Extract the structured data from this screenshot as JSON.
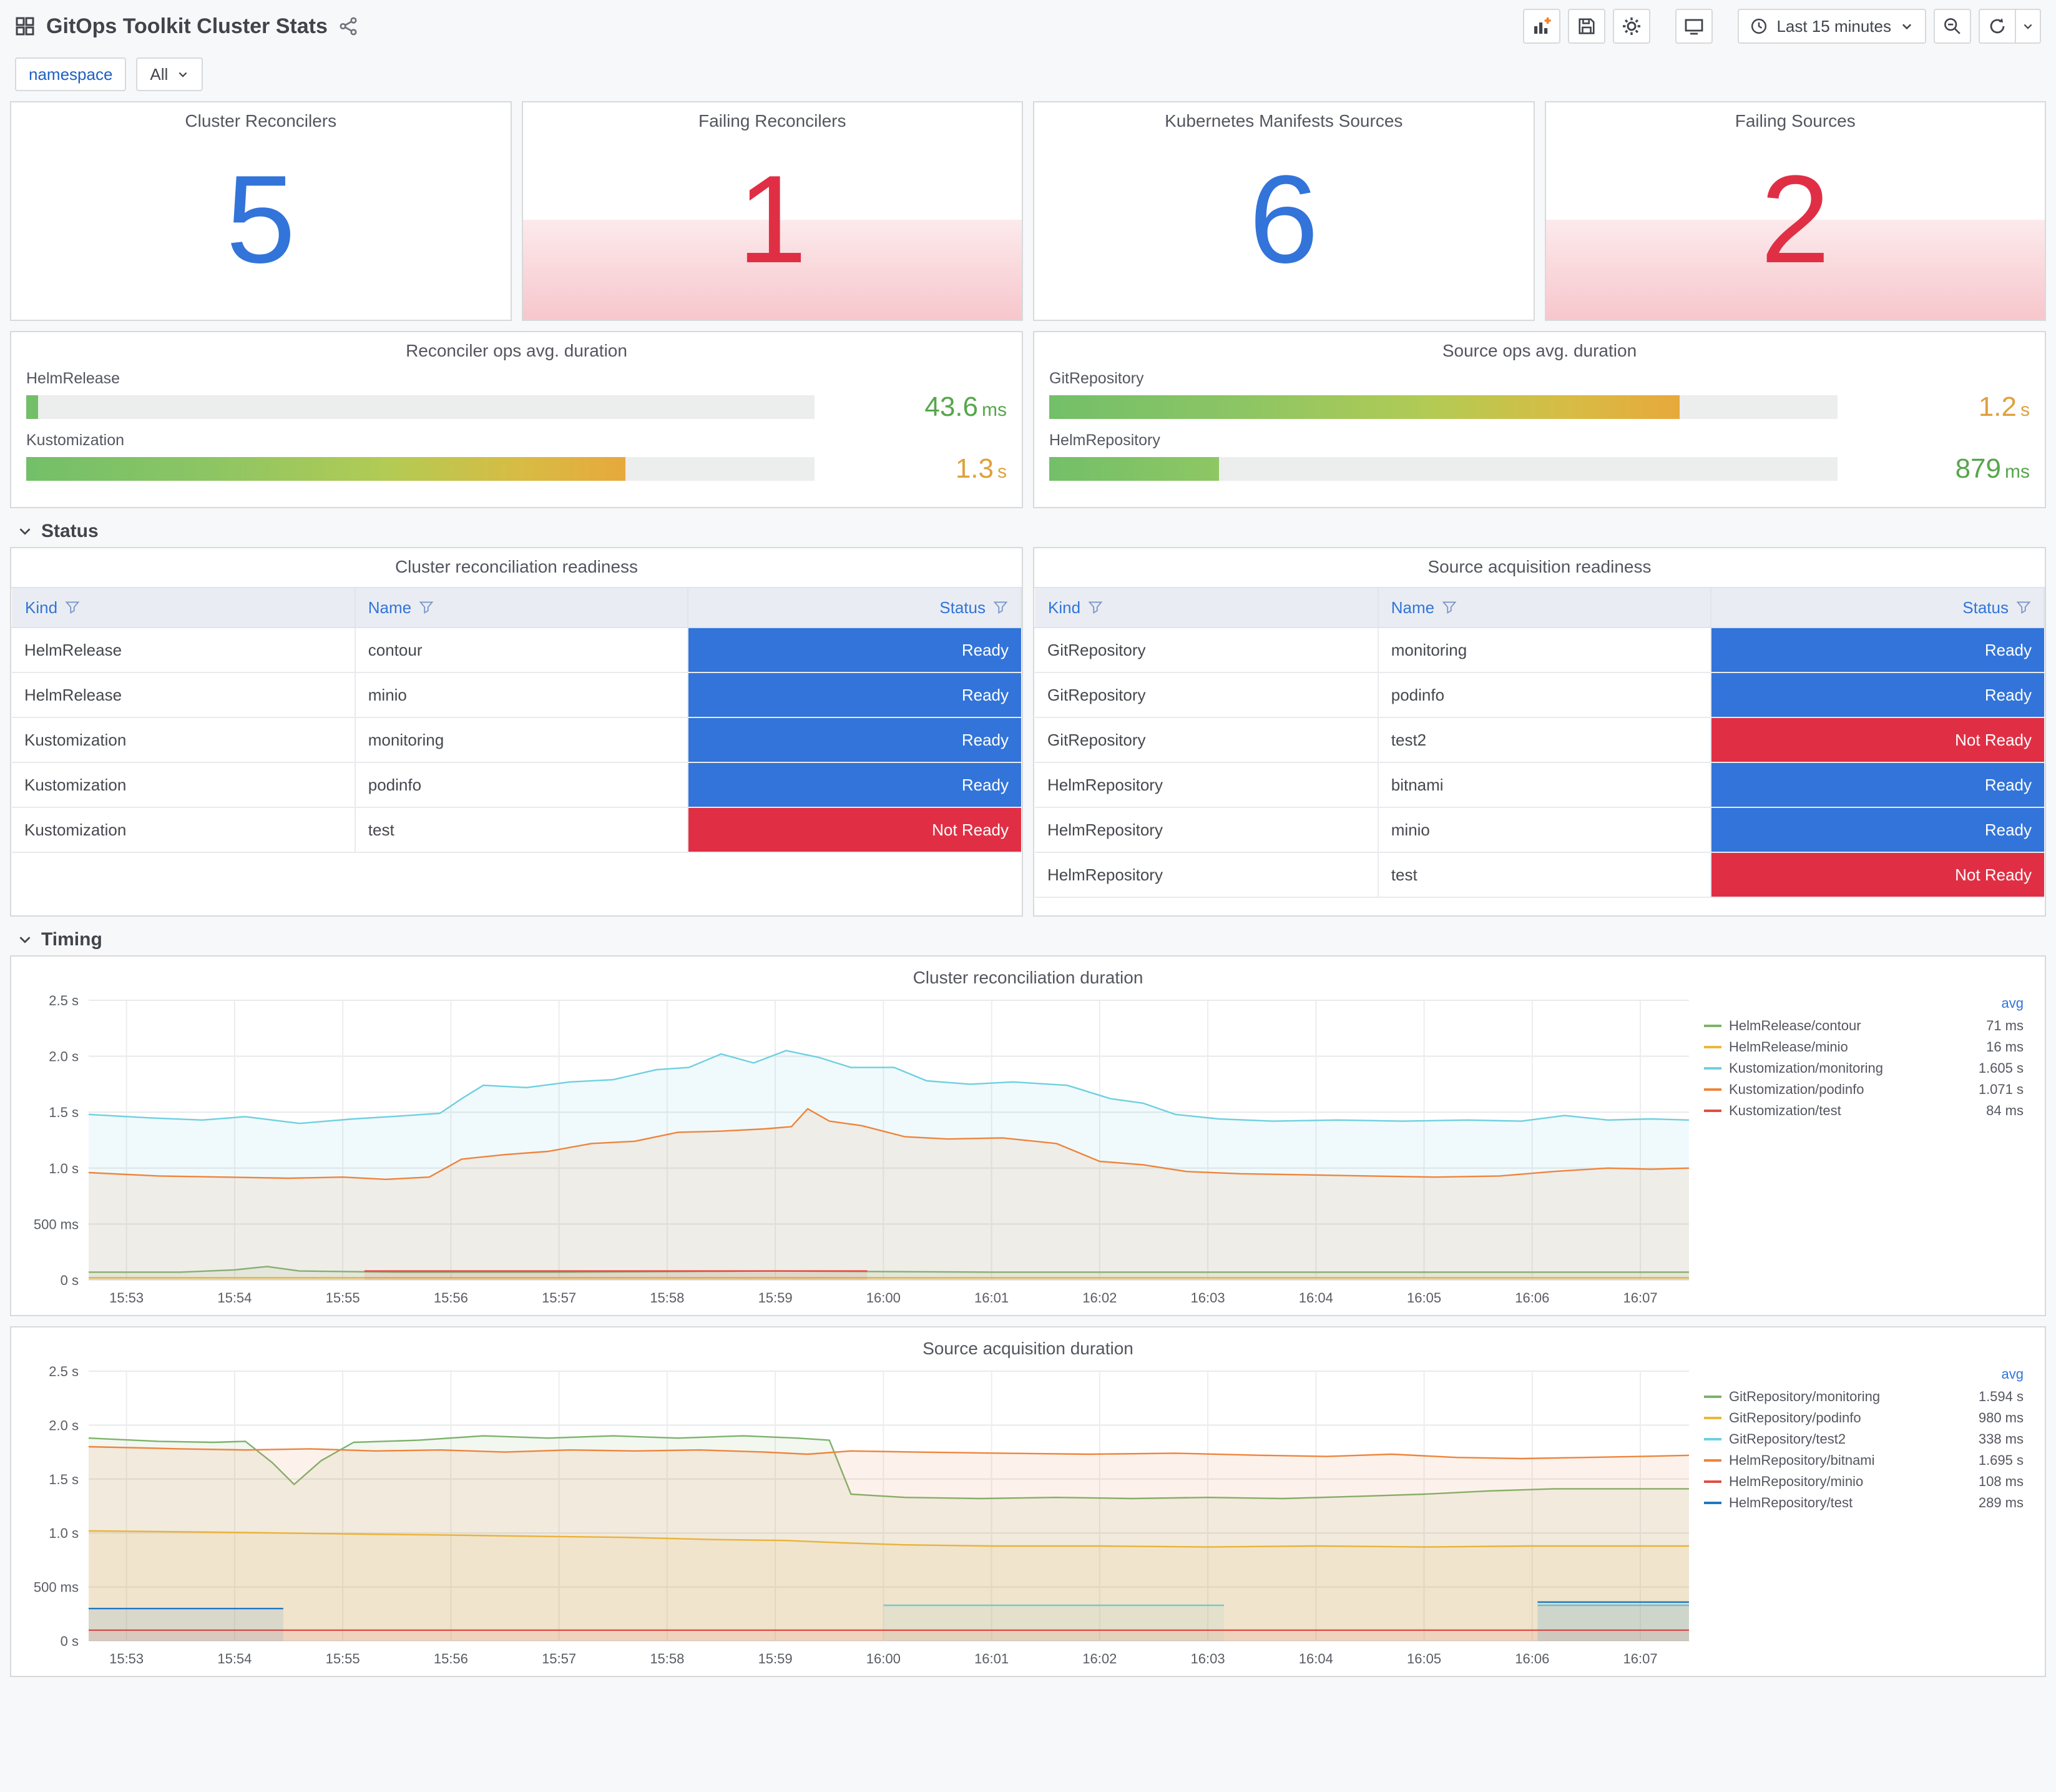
{
  "header": {
    "title": "GitOps Toolkit Cluster Stats",
    "time_picker": "Last 15 minutes"
  },
  "variables": {
    "label": "namespace",
    "value": "All"
  },
  "colors": {
    "ok": "#3274d9",
    "alert": "#e02f44"
  },
  "stats": [
    {
      "title": "Cluster Reconcilers",
      "value": "5",
      "state": "ok"
    },
    {
      "title": "Failing Reconcilers",
      "value": "1",
      "state": "alert"
    },
    {
      "title": "Kubernetes Manifests Sources",
      "value": "6",
      "state": "ok"
    },
    {
      "title": "Failing Sources",
      "value": "2",
      "state": "alert"
    }
  ],
  "gauges": [
    {
      "title": "Reconciler ops avg. duration",
      "rows": [
        {
          "label": "HelmRelease",
          "value": "43.6",
          "unit": "ms",
          "pct": 1.5,
          "bar": "solid",
          "value_color": "#56a64b"
        },
        {
          "label": "Kustomization",
          "value": "1.3",
          "unit": "s",
          "pct": 76,
          "bar": "gradient",
          "value_color": "#e0a03c"
        }
      ]
    },
    {
      "title": "Source ops avg. duration",
      "rows": [
        {
          "label": "GitRepository",
          "value": "1.2",
          "unit": "s",
          "pct": 80,
          "bar": "gradient",
          "value_color": "#e0a03c"
        },
        {
          "label": "HelmRepository",
          "value": "879",
          "unit": "ms",
          "pct": 21.5,
          "bar": "green",
          "value_color": "#56a64b"
        }
      ]
    }
  ],
  "sections": {
    "status": "Status",
    "timing": "Timing"
  },
  "status_colors": {
    "Ready": "#3274d9",
    "Not Ready": "#e02f44"
  },
  "tables": [
    {
      "title": "Cluster reconciliation readiness",
      "columns": [
        "Kind",
        "Name",
        "Status"
      ],
      "rows": [
        {
          "kind": "HelmRelease",
          "name": "contour",
          "status": "Ready"
        },
        {
          "kind": "HelmRelease",
          "name": "minio",
          "status": "Ready"
        },
        {
          "kind": "Kustomization",
          "name": "monitoring",
          "status": "Ready"
        },
        {
          "kind": "Kustomization",
          "name": "podinfo",
          "status": "Ready"
        },
        {
          "kind": "Kustomization",
          "name": "test",
          "status": "Not Ready"
        }
      ]
    },
    {
      "title": "Source acquisition readiness",
      "columns": [
        "Kind",
        "Name",
        "Status"
      ],
      "rows": [
        {
          "kind": "GitRepository",
          "name": "monitoring",
          "status": "Ready"
        },
        {
          "kind": "GitRepository",
          "name": "podinfo",
          "status": "Ready"
        },
        {
          "kind": "GitRepository",
          "name": "test2",
          "status": "Not Ready"
        },
        {
          "kind": "HelmRepository",
          "name": "bitnami",
          "status": "Ready"
        },
        {
          "kind": "HelmRepository",
          "name": "minio",
          "status": "Ready"
        },
        {
          "kind": "HelmRepository",
          "name": "test",
          "status": "Not Ready"
        }
      ]
    }
  ],
  "chart_data": [
    {
      "type": "line",
      "title": "Cluster reconciliation duration",
      "xlabel": "",
      "ylabel": "",
      "legend_header": "avg",
      "x_range": [
        -0.35,
        14.45
      ],
      "y_range": [
        0,
        2.5
      ],
      "x_tick_values": [
        0,
        1,
        2,
        3,
        4,
        5,
        6,
        7,
        8,
        9,
        10,
        11,
        12,
        13,
        14
      ],
      "x_tick_labels": [
        "15:53",
        "15:54",
        "15:55",
        "15:56",
        "15:57",
        "15:58",
        "15:59",
        "16:00",
        "16:01",
        "16:02",
        "16:03",
        "16:04",
        "16:05",
        "16:06",
        "16:07"
      ],
      "y_ticks": [
        {
          "v": 0,
          "label": "0 s"
        },
        {
          "v": 0.5,
          "label": "500 ms"
        },
        {
          "v": 1,
          "label": "1.0 s"
        },
        {
          "v": 1.5,
          "label": "1.5 s"
        },
        {
          "v": 2,
          "label": "2.0 s"
        },
        {
          "v": 2.5,
          "label": "2.5 s"
        }
      ],
      "series": [
        {
          "name": "HelmRelease/contour",
          "avg": "71 ms",
          "color": "#7eb26d",
          "points": [
            [
              -0.35,
              0.07
            ],
            [
              0.5,
              0.07
            ],
            [
              1.0,
              0.09
            ],
            [
              1.3,
              0.12
            ],
            [
              1.6,
              0.08
            ],
            [
              2.5,
              0.07
            ],
            [
              4,
              0.07
            ],
            [
              6,
              0.08
            ],
            [
              8,
              0.07
            ],
            [
              10,
              0.07
            ],
            [
              12,
              0.07
            ],
            [
              14.45,
              0.07
            ]
          ]
        },
        {
          "name": "HelmRelease/minio",
          "avg": "16 ms",
          "color": "#eab839",
          "points": [
            [
              -0.35,
              0.02
            ],
            [
              14.45,
              0.02
            ]
          ]
        },
        {
          "name": "Kustomization/monitoring",
          "avg": "1.605 s",
          "color": "#6ed0e0",
          "points": [
            [
              -0.35,
              1.48
            ],
            [
              0.2,
              1.45
            ],
            [
              0.7,
              1.43
            ],
            [
              1.1,
              1.46
            ],
            [
              1.6,
              1.4
            ],
            [
              2.1,
              1.44
            ],
            [
              2.6,
              1.47
            ],
            [
              2.9,
              1.49
            ],
            [
              3.1,
              1.62
            ],
            [
              3.3,
              1.74
            ],
            [
              3.7,
              1.72
            ],
            [
              4.1,
              1.77
            ],
            [
              4.5,
              1.79
            ],
            [
              4.9,
              1.88
            ],
            [
              5.2,
              1.9
            ],
            [
              5.5,
              2.02
            ],
            [
              5.8,
              1.94
            ],
            [
              6.1,
              2.05
            ],
            [
              6.4,
              1.99
            ],
            [
              6.7,
              1.9
            ],
            [
              7.1,
              1.9
            ],
            [
              7.4,
              1.78
            ],
            [
              7.8,
              1.75
            ],
            [
              8.2,
              1.77
            ],
            [
              8.7,
              1.74
            ],
            [
              9.1,
              1.62
            ],
            [
              9.4,
              1.58
            ],
            [
              9.7,
              1.48
            ],
            [
              10.1,
              1.44
            ],
            [
              10.6,
              1.42
            ],
            [
              11.2,
              1.43
            ],
            [
              11.8,
              1.42
            ],
            [
              12.4,
              1.43
            ],
            [
              12.9,
              1.42
            ],
            [
              13.3,
              1.47
            ],
            [
              13.7,
              1.43
            ],
            [
              14.1,
              1.44
            ],
            [
              14.45,
              1.43
            ]
          ]
        },
        {
          "name": "Kustomization/podinfo",
          "avg": "1.071 s",
          "color": "#ef843c",
          "points": [
            [
              -0.35,
              0.96
            ],
            [
              0.3,
              0.93
            ],
            [
              0.9,
              0.92
            ],
            [
              1.5,
              0.91
            ],
            [
              2.0,
              0.92
            ],
            [
              2.4,
              0.9
            ],
            [
              2.8,
              0.92
            ],
            [
              3.1,
              1.08
            ],
            [
              3.5,
              1.12
            ],
            [
              3.9,
              1.15
            ],
            [
              4.3,
              1.22
            ],
            [
              4.7,
              1.24
            ],
            [
              5.1,
              1.32
            ],
            [
              5.5,
              1.33
            ],
            [
              5.9,
              1.35
            ],
            [
              6.15,
              1.37
            ],
            [
              6.3,
              1.53
            ],
            [
              6.5,
              1.42
            ],
            [
              6.8,
              1.38
            ],
            [
              7.2,
              1.28
            ],
            [
              7.6,
              1.26
            ],
            [
              8.1,
              1.27
            ],
            [
              8.6,
              1.22
            ],
            [
              9.0,
              1.06
            ],
            [
              9.4,
              1.03
            ],
            [
              9.8,
              0.97
            ],
            [
              10.3,
              0.95
            ],
            [
              10.9,
              0.94
            ],
            [
              11.5,
              0.93
            ],
            [
              12.1,
              0.92
            ],
            [
              12.7,
              0.93
            ],
            [
              13.2,
              0.97
            ],
            [
              13.7,
              1.0
            ],
            [
              14.1,
              0.99
            ],
            [
              14.45,
              1.0
            ]
          ]
        },
        {
          "name": "Kustomization/test",
          "avg": "84 ms",
          "color": "#e24d42",
          "points": [
            [
              2.2,
              0.08
            ],
            [
              6.85,
              0.08
            ]
          ]
        }
      ]
    },
    {
      "type": "line",
      "title": "Source acquisition duration",
      "xlabel": "",
      "ylabel": "",
      "legend_header": "avg",
      "x_range": [
        -0.35,
        14.45
      ],
      "y_range": [
        0,
        2.5
      ],
      "x_tick_values": [
        0,
        1,
        2,
        3,
        4,
        5,
        6,
        7,
        8,
        9,
        10,
        11,
        12,
        13,
        14
      ],
      "x_tick_labels": [
        "15:53",
        "15:54",
        "15:55",
        "15:56",
        "15:57",
        "15:58",
        "15:59",
        "16:00",
        "16:01",
        "16:02",
        "16:03",
        "16:04",
        "16:05",
        "16:06",
        "16:07"
      ],
      "y_ticks": [
        {
          "v": 0,
          "label": "0 s"
        },
        {
          "v": 0.5,
          "label": "500 ms"
        },
        {
          "v": 1,
          "label": "1.0 s"
        },
        {
          "v": 1.5,
          "label": "1.5 s"
        },
        {
          "v": 2,
          "label": "2.0 s"
        },
        {
          "v": 2.5,
          "label": "2.5 s"
        }
      ],
      "series": [
        {
          "name": "GitRepository/monitoring",
          "avg": "1.594 s",
          "color": "#7eb26d",
          "points": [
            [
              -0.35,
              1.88
            ],
            [
              0.3,
              1.85
            ],
            [
              0.8,
              1.84
            ],
            [
              1.1,
              1.85
            ],
            [
              1.35,
              1.65
            ],
            [
              1.55,
              1.45
            ],
            [
              1.8,
              1.67
            ],
            [
              2.1,
              1.84
            ],
            [
              2.7,
              1.86
            ],
            [
              3.3,
              1.9
            ],
            [
              3.9,
              1.88
            ],
            [
              4.5,
              1.9
            ],
            [
              5.1,
              1.88
            ],
            [
              5.7,
              1.9
            ],
            [
              6.2,
              1.88
            ],
            [
              6.5,
              1.86
            ],
            [
              6.7,
              1.36
            ],
            [
              7.2,
              1.33
            ],
            [
              7.9,
              1.32
            ],
            [
              8.6,
              1.33
            ],
            [
              9.3,
              1.32
            ],
            [
              10.0,
              1.33
            ],
            [
              10.7,
              1.32
            ],
            [
              11.4,
              1.34
            ],
            [
              12.0,
              1.36
            ],
            [
              12.6,
              1.39
            ],
            [
              13.2,
              1.41
            ],
            [
              13.9,
              1.41
            ],
            [
              14.45,
              1.41
            ]
          ]
        },
        {
          "name": "GitRepository/podinfo",
          "avg": "980 ms",
          "color": "#eab839",
          "points": [
            [
              -0.35,
              1.02
            ],
            [
              0.6,
              1.01
            ],
            [
              1.4,
              1.0
            ],
            [
              2.2,
              0.99
            ],
            [
              3.0,
              0.98
            ],
            [
              3.8,
              0.97
            ],
            [
              4.6,
              0.96
            ],
            [
              5.4,
              0.94
            ],
            [
              6.1,
              0.93
            ],
            [
              6.6,
              0.91
            ],
            [
              7.2,
              0.89
            ],
            [
              8.0,
              0.88
            ],
            [
              9.0,
              0.88
            ],
            [
              10.0,
              0.87
            ],
            [
              11.0,
              0.88
            ],
            [
              12.0,
              0.87
            ],
            [
              13.0,
              0.88
            ],
            [
              14.0,
              0.88
            ],
            [
              14.45,
              0.88
            ]
          ]
        },
        {
          "name": "GitRepository/test2",
          "avg": "338 ms",
          "color": "#6ed0e0",
          "points": [
            [
              7.0,
              0.33
            ],
            [
              10.15,
              0.33
            ],
            [
              10.5,
              null
            ],
            [
              13.05,
              0.33
            ],
            [
              14.45,
              0.33
            ]
          ]
        },
        {
          "name": "HelmRepository/bitnami",
          "avg": "1.695 s",
          "color": "#ef843c",
          "points": [
            [
              -0.35,
              1.8
            ],
            [
              0.5,
              1.78
            ],
            [
              1.1,
              1.77
            ],
            [
              1.7,
              1.78
            ],
            [
              2.3,
              1.76
            ],
            [
              2.9,
              1.77
            ],
            [
              3.5,
              1.75
            ],
            [
              4.1,
              1.77
            ],
            [
              4.7,
              1.76
            ],
            [
              5.3,
              1.77
            ],
            [
              5.9,
              1.75
            ],
            [
              6.3,
              1.73
            ],
            [
              6.7,
              1.76
            ],
            [
              7.3,
              1.75
            ],
            [
              8.1,
              1.74
            ],
            [
              8.9,
              1.73
            ],
            [
              9.7,
              1.74
            ],
            [
              10.5,
              1.72
            ],
            [
              11.1,
              1.71
            ],
            [
              11.7,
              1.73
            ],
            [
              12.3,
              1.7
            ],
            [
              12.9,
              1.69
            ],
            [
              13.5,
              1.7
            ],
            [
              14.0,
              1.71
            ],
            [
              14.45,
              1.72
            ]
          ]
        },
        {
          "name": "HelmRepository/minio",
          "avg": "108 ms",
          "color": "#e24d42",
          "points": [
            [
              -0.35,
              0.1
            ],
            [
              14.45,
              0.1
            ]
          ]
        },
        {
          "name": "HelmRepository/test",
          "avg": "289 ms",
          "color": "#1f78c1",
          "points": [
            [
              -0.35,
              0.3
            ],
            [
              1.45,
              0.3
            ],
            [
              1.6,
              null
            ],
            [
              13.05,
              0.36
            ],
            [
              14.45,
              0.36
            ]
          ]
        }
      ]
    }
  ]
}
